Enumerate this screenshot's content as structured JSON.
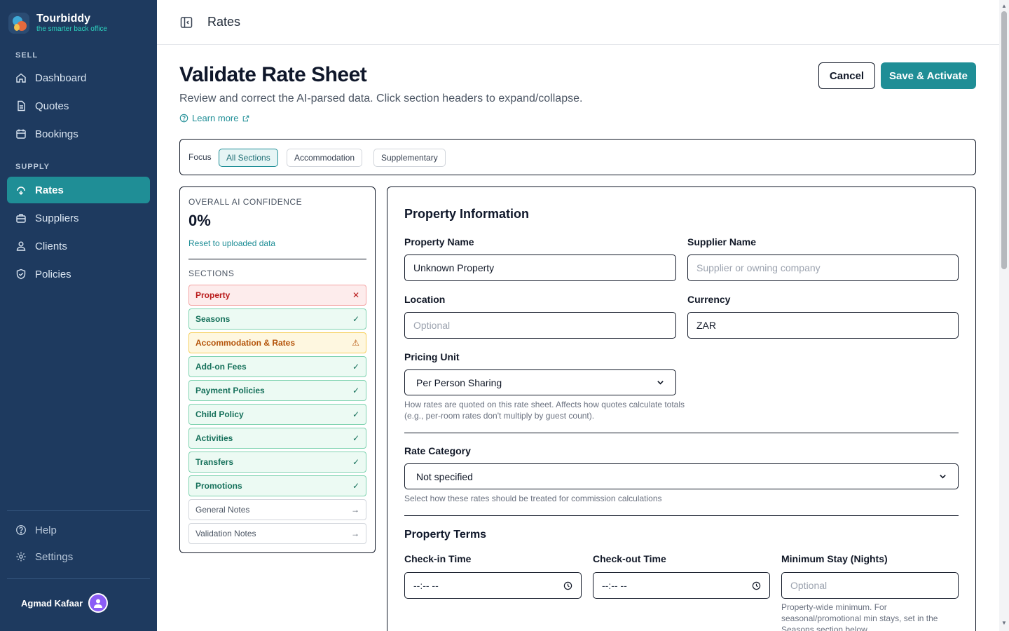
{
  "brand": {
    "name": "Tourbiddy",
    "tagline": "the smarter back office"
  },
  "sidebar": {
    "sell_label": "SELL",
    "sell_items": [
      {
        "label": "Dashboard",
        "icon": "home-icon"
      },
      {
        "label": "Quotes",
        "icon": "document-icon"
      },
      {
        "label": "Bookings",
        "icon": "calendar-icon"
      }
    ],
    "supply_label": "SUPPLY",
    "supply_items": [
      {
        "label": "Rates",
        "icon": "rates-icon",
        "active": true
      },
      {
        "label": "Suppliers",
        "icon": "briefcase-icon"
      },
      {
        "label": "Clients",
        "icon": "user-icon"
      },
      {
        "label": "Policies",
        "icon": "shield-icon"
      }
    ],
    "bottom_items": [
      {
        "label": "Help",
        "icon": "help-icon"
      },
      {
        "label": "Settings",
        "icon": "gear-icon"
      }
    ],
    "user_name": "Agmad Kafaar"
  },
  "topbar": {
    "title": "Rates"
  },
  "header": {
    "title": "Validate Rate Sheet",
    "subtitle": "Review and correct the AI-parsed data. Click section headers to expand/collapse.",
    "learn_more": "Learn more",
    "cancel_label": "Cancel",
    "save_label": "Save & Activate"
  },
  "focus": {
    "label": "Focus",
    "chips": [
      "All Sections",
      "Accommodation",
      "Supplementary"
    ],
    "active": "All Sections"
  },
  "confidence": {
    "label": "OVERALL AI CONFIDENCE",
    "value": "0%",
    "reset_label": "Reset to uploaded data"
  },
  "sections": {
    "label": "SECTIONS",
    "items": [
      {
        "label": "Property",
        "status": "error",
        "mark": "✕"
      },
      {
        "label": "Seasons",
        "status": "ok",
        "mark": "✓"
      },
      {
        "label": "Accommodation & Rates",
        "status": "warn",
        "mark": "⚠"
      },
      {
        "label": "Add-on Fees",
        "status": "ok",
        "mark": "✓"
      },
      {
        "label": "Payment Policies",
        "status": "ok",
        "mark": "✓"
      },
      {
        "label": "Child Policy",
        "status": "ok",
        "mark": "✓"
      },
      {
        "label": "Activities",
        "status": "ok",
        "mark": "✓"
      },
      {
        "label": "Transfers",
        "status": "ok",
        "mark": "✓"
      },
      {
        "label": "Promotions",
        "status": "ok",
        "mark": "✓"
      },
      {
        "label": "General Notes",
        "status": "neutral",
        "mark": "→"
      },
      {
        "label": "Validation Notes",
        "status": "neutral",
        "mark": "→"
      }
    ]
  },
  "property_info": {
    "heading": "Property Information",
    "property_name_label": "Property Name",
    "property_name_value": "Unknown Property",
    "supplier_name_label": "Supplier Name",
    "supplier_name_placeholder": "Supplier or owning company",
    "location_label": "Location",
    "location_placeholder": "Optional",
    "currency_label": "Currency",
    "currency_value": "ZAR",
    "pricing_unit_label": "Pricing Unit",
    "pricing_unit_value": "Per Person Sharing",
    "pricing_unit_help": "How rates are quoted on this rate sheet. Affects how quotes calculate totals (e.g., per-room rates don't multiply by guest count).",
    "rate_category_label": "Rate Category",
    "rate_category_value": "Not specified",
    "rate_category_help": "Select how these rates should be treated for commission calculations"
  },
  "property_terms": {
    "heading": "Property Terms",
    "checkin_label": "Check-in Time",
    "checkin_value": "--:-- --",
    "checkout_label": "Check-out Time",
    "checkout_value": "--:-- --",
    "min_stay_label": "Minimum Stay (Nights)",
    "min_stay_placeholder": "Optional",
    "min_stay_help": "Property-wide minimum. For seasonal/promotional min stays, set in the Seasons section below."
  }
}
